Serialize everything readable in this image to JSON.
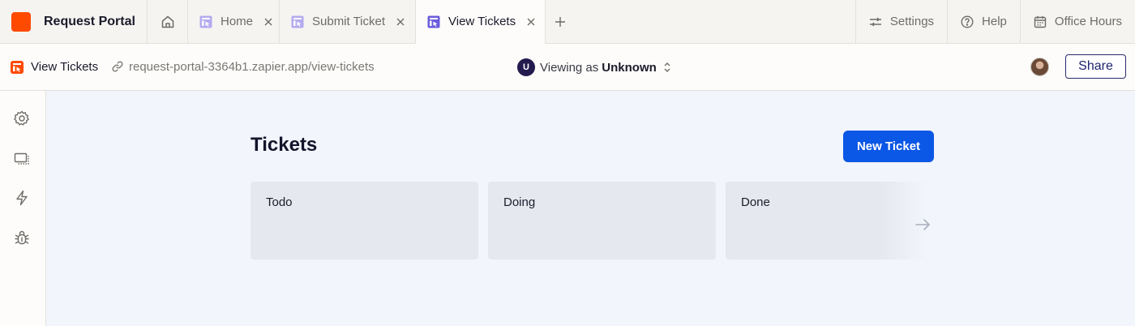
{
  "app": {
    "name": "Request Portal",
    "brand_color": "#ff4a00"
  },
  "tabs": [
    {
      "label": "Home",
      "active": false,
      "icon": "page-icon"
    },
    {
      "label": "Submit Ticket",
      "active": false,
      "icon": "page-icon"
    },
    {
      "label": "View Tickets",
      "active": true,
      "icon": "page-icon"
    }
  ],
  "top_actions": {
    "settings": "Settings",
    "help": "Help",
    "office_hours": "Office Hours"
  },
  "address": {
    "page_name": "View Tickets",
    "url": "request-portal-3364b1.zapier.app/view-tickets"
  },
  "viewing": {
    "prefix": "Viewing as",
    "role": "Unknown",
    "avatar_initial": "U"
  },
  "share_label": "Share",
  "sidebar_icons": [
    "gear-icon",
    "screens-icon",
    "lightning-icon",
    "bug-icon"
  ],
  "main": {
    "title": "Tickets",
    "new_ticket_label": "New Ticket",
    "columns": [
      "Todo",
      "Doing",
      "Done"
    ]
  },
  "colors": {
    "primary_button": "#0b57e6",
    "active_tab_icon": "#6b5bdc"
  }
}
